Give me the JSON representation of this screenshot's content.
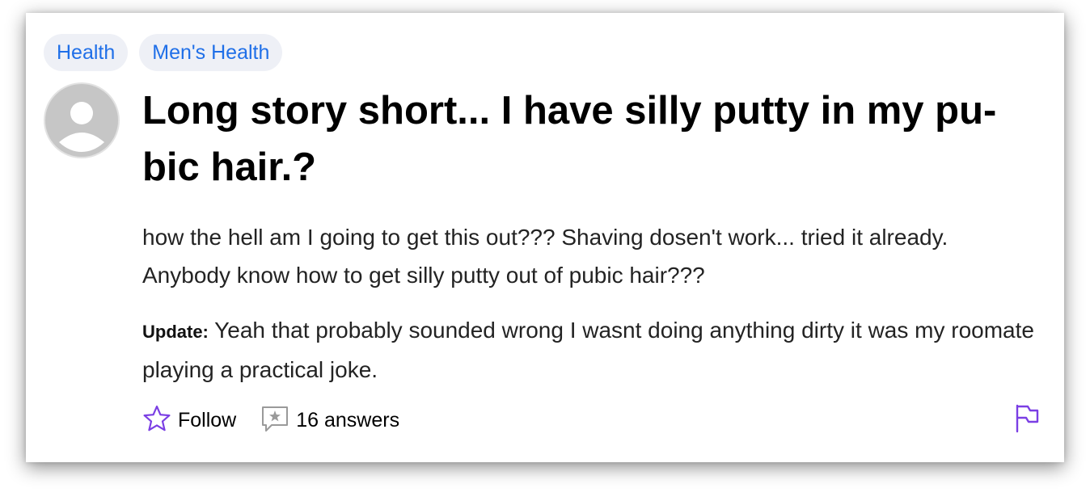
{
  "tags": [
    {
      "label": "Health"
    },
    {
      "label": "Men's Health"
    }
  ],
  "question": {
    "title": "Long story short... I have silly putty in my pu­bic hair.?",
    "body": "how the hell am I going to get this out??? Shaving dosen't work... tried it already. Anybody know how to get silly putty out of pubic hair???",
    "update_label": "Update:",
    "update_text": "Yeah that probably sounded wrong I wasnt doing anything dirty it was my roomate playing a practical joke."
  },
  "actions": {
    "follow_label": "Follow",
    "answers_label": "16 answers"
  },
  "icons": {
    "avatar": "default-user-avatar-icon",
    "follow": "star-outline-icon",
    "answers": "answer-bubble-icon",
    "report": "flag-icon"
  },
  "colors": {
    "tag_text": "#1f6fe8",
    "tag_background": "#eef0f6",
    "icon_accent": "#7b3fe4"
  }
}
